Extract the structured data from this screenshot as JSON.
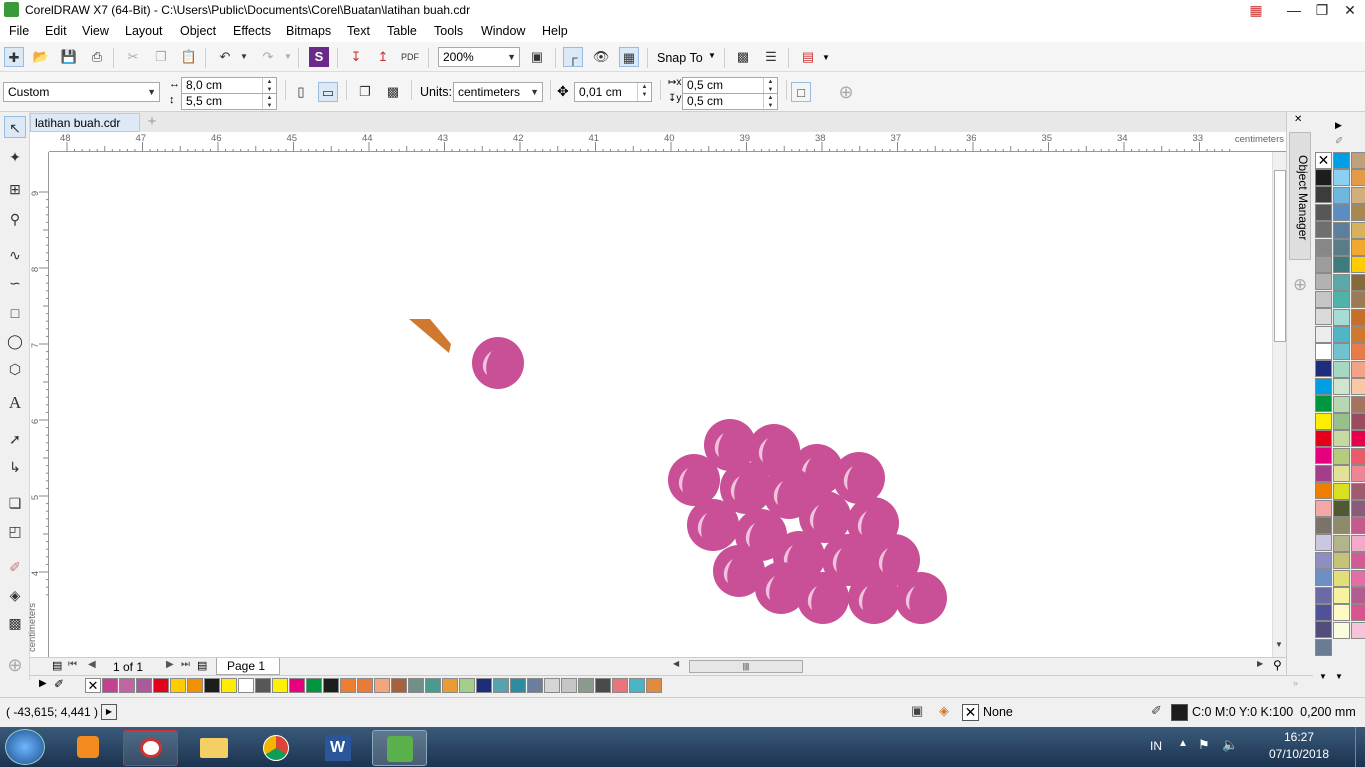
{
  "window": {
    "title": "CorelDRAW X7 (64-Bit) - C:\\Users\\Public\\Documents\\Corel\\Buatan\\latihan buah.cdr"
  },
  "menu": [
    "File",
    "Edit",
    "View",
    "Layout",
    "Object",
    "Effects",
    "Bitmaps",
    "Text",
    "Table",
    "Tools",
    "Window",
    "Help"
  ],
  "toolbar": {
    "zoom": "200%",
    "snap_to": "Snap To"
  },
  "propbar": {
    "page_size": "Custom",
    "width": "8,0 cm",
    "height": "5,5 cm",
    "units_label": "Units:",
    "units": "centimeters",
    "nudge": "0,01 cm",
    "dup_x": "0,5 cm",
    "dup_y": "0,5 cm"
  },
  "doc_tab": "latihan buah.cdr",
  "ruler": {
    "h_ticks": [
      "48",
      "47",
      "46",
      "45",
      "44",
      "43",
      "42",
      "41",
      "40",
      "39",
      "38",
      "37",
      "36",
      "35",
      "34",
      "33"
    ],
    "h_unit": "centimeters",
    "v_ticks": [
      "9",
      "8",
      "7",
      "6",
      "5",
      "4"
    ],
    "v_unit": "centimeters"
  },
  "page_nav": {
    "count": "1 of 1",
    "page_tab": "Page 1"
  },
  "docker_title": "Object Manager",
  "status": {
    "coords": "( -43,615; 4,441 )",
    "fill": "None",
    "outline": "C:0 M:0 Y:0 K:100  0,200 mm"
  },
  "taskbar": {
    "lang": "IN",
    "time": "16:27",
    "date": "07/10/2018"
  },
  "colors": {
    "grape": "#c94f96",
    "highlight": "#f1c2de",
    "stem": "#d0782e",
    "doc_palette": [
      "#c24190",
      "#c065a0",
      "#a95a9a",
      "#e2001a",
      "#ffcc00",
      "#f39200",
      "#1d1d1b",
      "#ffed00",
      "#ffffff",
      "#575756",
      "#fff200",
      "#e6007e",
      "#009640",
      "#1d1d1b",
      "#ef7d2f",
      "#e77c3a",
      "#f4a57c",
      "#a6613e",
      "#6f8f88",
      "#4a9b8f",
      "#e99c35",
      "#a3cf8a",
      "#1d2d7c",
      "#55a3ae",
      "#2d8ca0",
      "#6b7f9c",
      "#d5d5d5",
      "#c6c6c6",
      "#8b9b8b",
      "#4a4a4a",
      "#e9757a",
      "#4ab3c4",
      "#e38b3c"
    ],
    "right_palette_col1": [
      "#1d1d1b",
      "#3c3c3b",
      "#575756",
      "#706f6f",
      "#878787",
      "#9d9d9c",
      "#b2b2b2",
      "#c6c6c6",
      "#dadada",
      "#ededed",
      "#ffffff",
      "#1d2d7c",
      "#009fe3",
      "#009640",
      "#ffed00",
      "#e2001a",
      "#e6007e",
      "#a43d8a",
      "#ee7d00",
      "#f4a7a7",
      "#7c7268",
      "#cbc6e2",
      "#8e8ec1",
      "#6d8fc4",
      "#6a6aa4",
      "#51519a",
      "#524e7c",
      "#6a7b94"
    ],
    "right_palette_col2": [
      "#009fe3",
      "#8bd0f0",
      "#6fb7df",
      "#5a8ec3",
      "#5e7f9c",
      "#5b7b88",
      "#3d7b7c",
      "#5aa9a6",
      "#4fb3a9",
      "#a9dbd5",
      "#50b5c4",
      "#72c1cf",
      "#a6d7c3",
      "#cfe5d0",
      "#b7d7b0",
      "#97c18c",
      "#c6d9a3",
      "#b5cb7d",
      "#e3e09a",
      "#d9e021",
      "#4f5a34",
      "#8d8b6a",
      "#b3b48a",
      "#c5c27a",
      "#e2df7b",
      "#f7f2a0",
      "#fff9c4",
      "#fbfbdf"
    ],
    "right_palette_col3": [
      "#c0a07a",
      "#e39a49",
      "#d4ae7a",
      "#a88852",
      "#d7b15d",
      "#f0a82e",
      "#ffcc00",
      "#876a3a",
      "#9a7b56",
      "#c56f2b",
      "#d0782e",
      "#e77b4a",
      "#f4a285",
      "#f7c7a6",
      "#a6735f",
      "#9b4b5e",
      "#e5004d",
      "#e85b6b",
      "#ef8594",
      "#a05b71",
      "#8a5b7a",
      "#c55a8c",
      "#f4a9c8",
      "#d15b94",
      "#e16fa5",
      "#b35c8f",
      "#d8548f",
      "#f5c4d9"
    ]
  }
}
